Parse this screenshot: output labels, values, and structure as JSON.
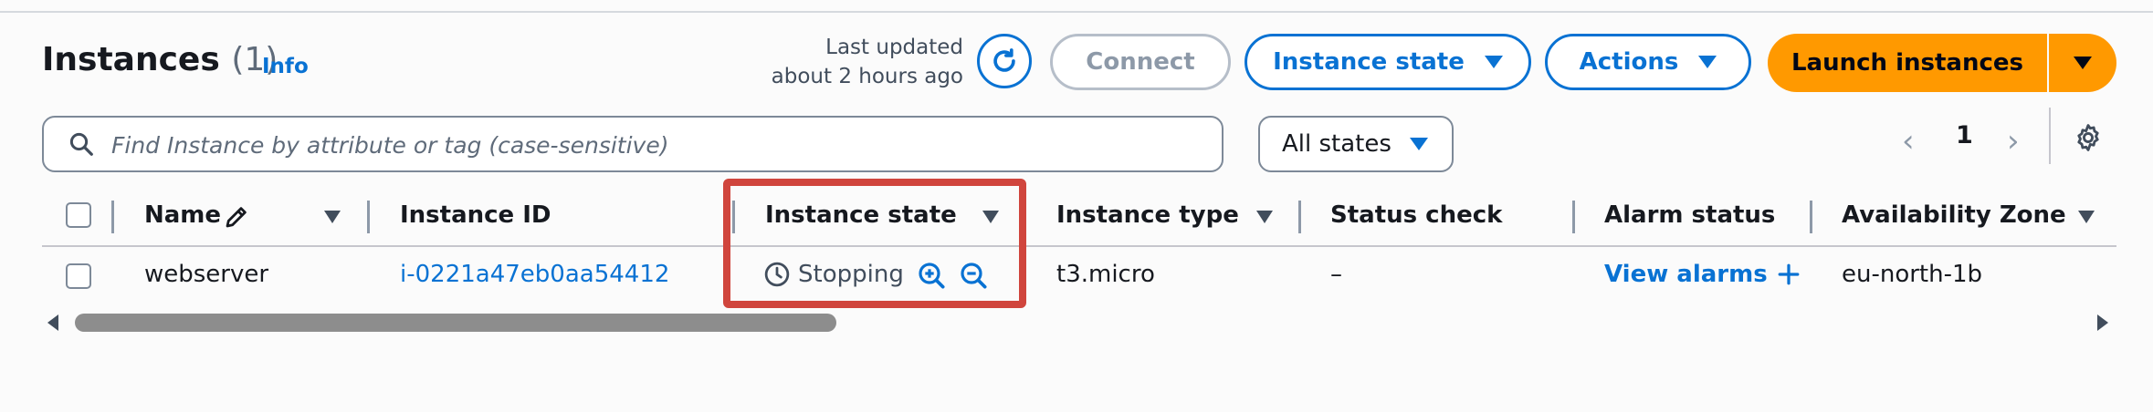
{
  "header": {
    "title": "Instances",
    "count": "(1)",
    "info_label": "Info",
    "last_updated_line1": "Last updated",
    "last_updated_line2": "about 2 hours ago"
  },
  "toolbar": {
    "connect_label": "Connect",
    "instance_state_label": "Instance state",
    "actions_label": "Actions",
    "launch_label": "Launch instances"
  },
  "filter": {
    "search_placeholder": "Find Instance by attribute or tag (case-sensitive)",
    "states_selected": "All states"
  },
  "pagination": {
    "current_page": "1",
    "prev_glyph": "‹",
    "next_glyph": "›"
  },
  "table": {
    "columns": [
      "Name",
      "Instance ID",
      "Instance state",
      "Instance type",
      "Status check",
      "Alarm status",
      "Availability Zone"
    ],
    "rows": [
      {
        "name": "webserver",
        "instance_id": "i-0221a47eb0aa54412",
        "instance_state": "Stopping",
        "instance_type": "t3.micro",
        "status_check": "–",
        "alarm_status": "View alarms",
        "availability_zone": "eu-north-1b"
      }
    ]
  },
  "colors": {
    "accent": "#0972d3",
    "launch": "#ff9900",
    "highlight": "#d0453d"
  },
  "icons": [
    "refresh-icon",
    "search-icon",
    "caret-down-icon",
    "chevron-left-icon",
    "chevron-right-icon",
    "settings-gear-icon",
    "edit-pencil-icon",
    "clock-icon",
    "zoom-in-icon",
    "zoom-out-icon",
    "plus-icon"
  ]
}
